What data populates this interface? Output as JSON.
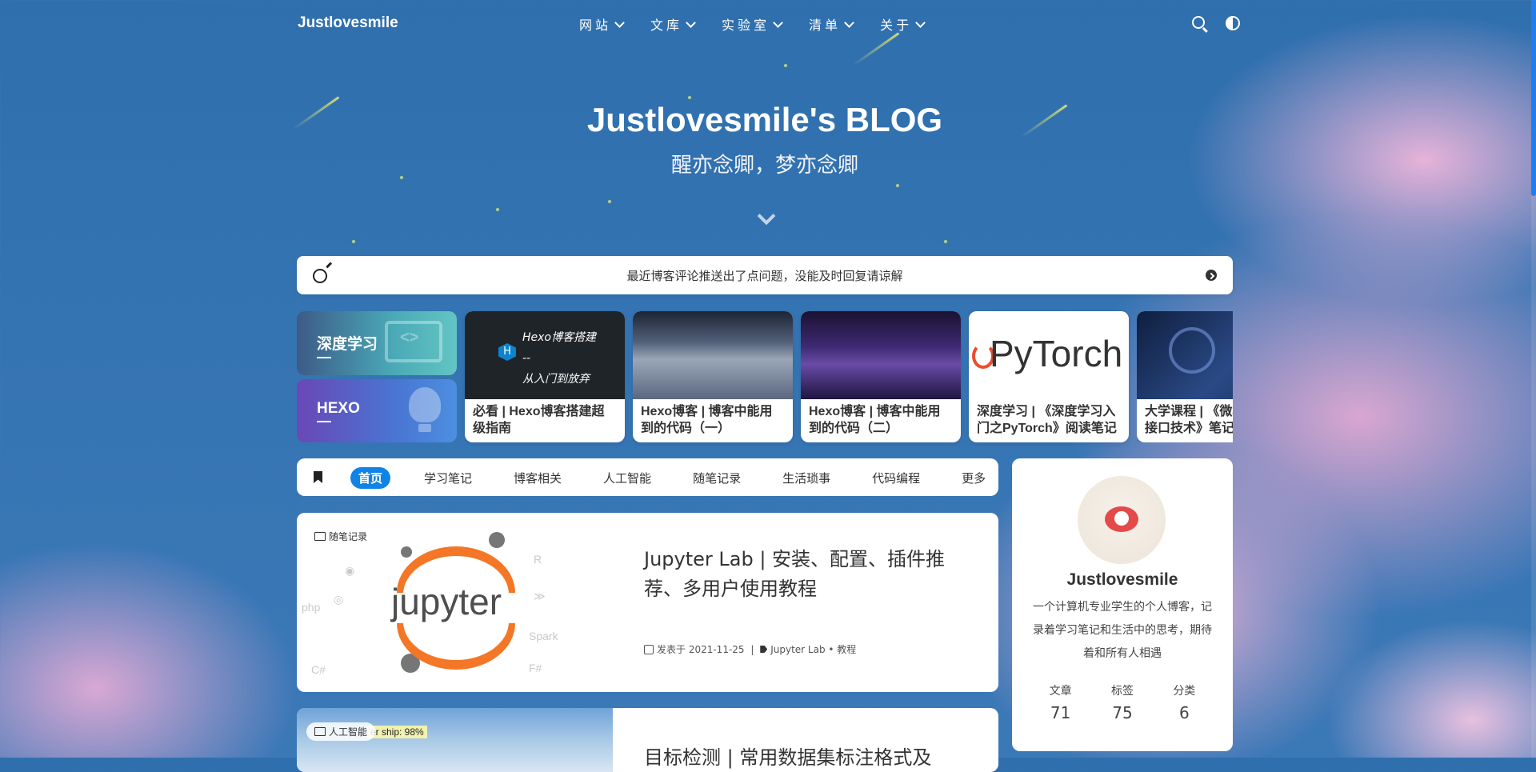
{
  "nav": {
    "brand": "Justlovesmile",
    "menu": [
      "网站",
      "文库",
      "实验室",
      "清单",
      "关于"
    ]
  },
  "hero": {
    "title": "Justlovesmile's BLOG",
    "subtitle": "醒亦念卿，梦亦念卿"
  },
  "notice": {
    "text": "最近博客评论推送出了点问题，没能及时回复请谅解"
  },
  "categories": [
    "深度学习",
    "HEXO"
  ],
  "featured": [
    {
      "title": "必看 | Hexo博客搭建超级指南",
      "thumb_text": "Hexo博客搭建\n--\n从入门到放弃"
    },
    {
      "title": "Hexo博客 | 博客中能用到的代码（一）"
    },
    {
      "title": "Hexo博客 | 博客中能用到的代码（二）"
    },
    {
      "title": "深度学习 | 《深度学习入门之PyTorch》阅读笔记",
      "thumb_text": "PyTorch"
    },
    {
      "title": "大学课程 | 《微机原理与接口技术》笔记"
    }
  ],
  "tabs": [
    "首页",
    "学习笔记",
    "博客相关",
    "人工智能",
    "随笔记录",
    "生活琐事",
    "代码编程",
    "更多"
  ],
  "posts": [
    {
      "category": "随笔记录",
      "title": "Jupyter Lab | 安装、配置、插件推荐、多用户使用教程",
      "date": "发表于 2021-11-25",
      "tags": "Jupyter Lab • 教程",
      "cover_word": "jupyter"
    },
    {
      "category": "人工智能",
      "title": "目标检测 | 常用数据集标注格式及",
      "cover_label": "er ship: 98%"
    }
  ],
  "profile": {
    "name": "Justlovesmile",
    "bio": "一个计算机专业学生的个人博客，记录着学习笔记和生活中的思考，期待着和所有人相遇",
    "stats": [
      {
        "label": "文章",
        "value": "71"
      },
      {
        "label": "标签",
        "value": "75"
      },
      {
        "label": "分类",
        "value": "6"
      }
    ]
  },
  "colors": {
    "accent": "#1083e6",
    "sky": "#3574b3",
    "cloud": "#e2b0d6"
  }
}
